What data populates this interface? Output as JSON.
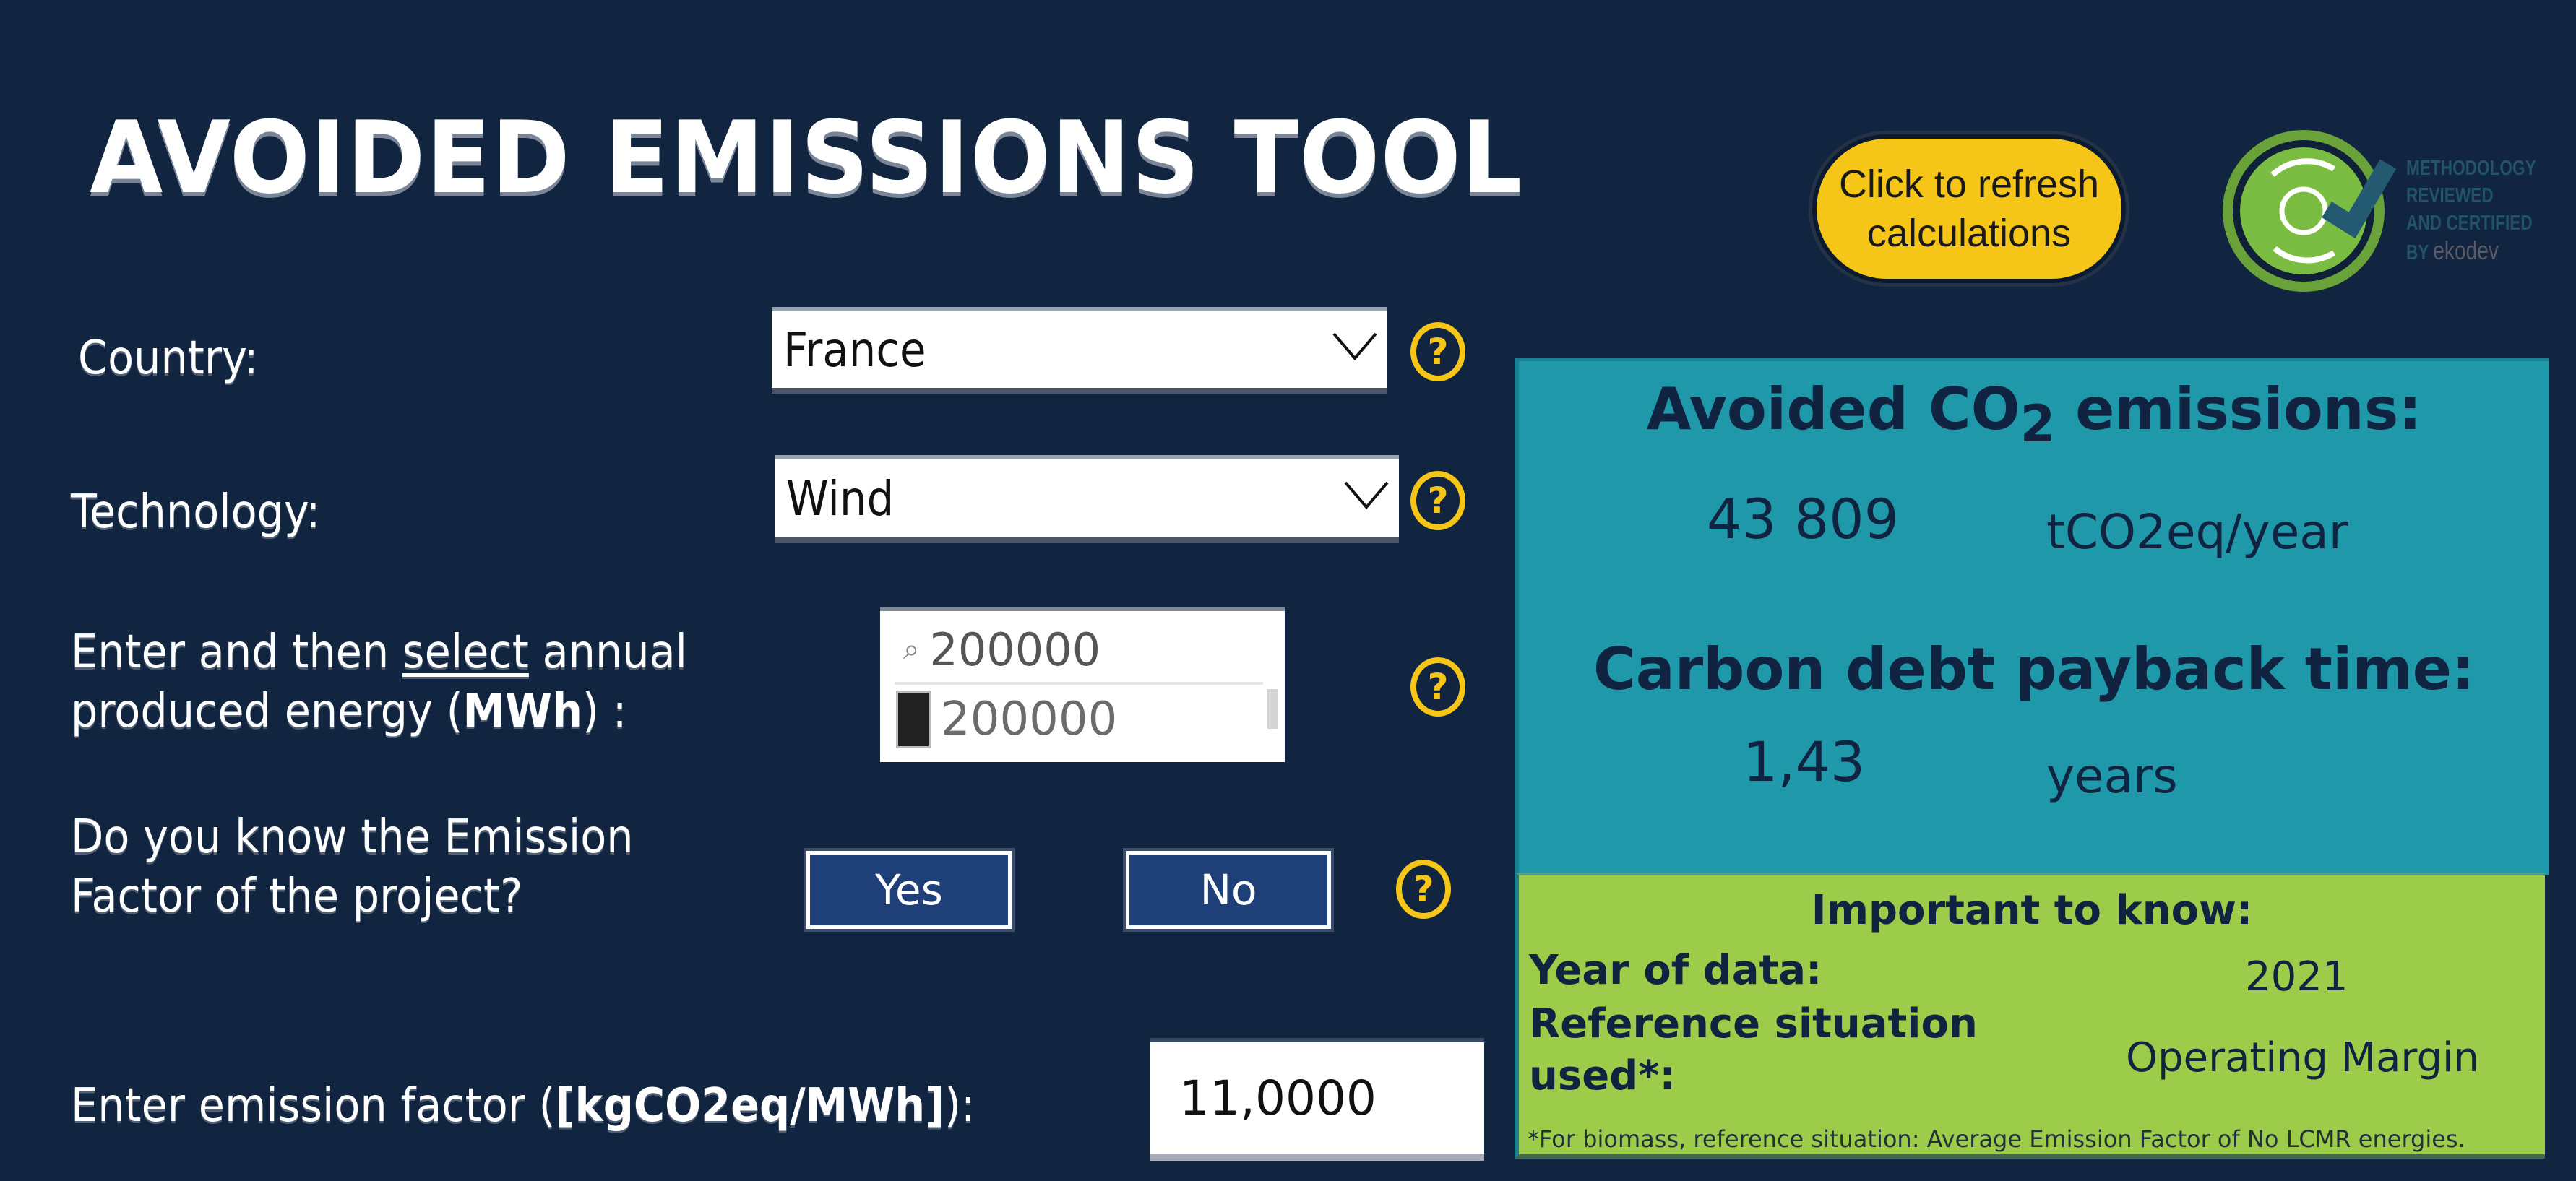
{
  "header": {
    "title": "AVOIDED EMISSIONS TOOL",
    "refresh_button": {
      "line1": "Click to refresh",
      "line2": "calculations"
    },
    "badge": {
      "line1": "METHODOLOGY",
      "line2": "REVIEWED",
      "line3": "AND CERTIFIED",
      "line4_prefix": "BY",
      "brand": "ekodev"
    }
  },
  "form": {
    "country": {
      "label": "Country:",
      "value": "France"
    },
    "technology": {
      "label": "Technology:",
      "value": "Wind"
    },
    "energy": {
      "label_part1": "Enter and then ",
      "label_underlined": "select",
      "label_part2": " annual",
      "label_line2_prefix": "produced energy (",
      "label_line2_bold": "MWh",
      "label_line2_suffix": ") :",
      "search_value": "200000",
      "option_value": "200000",
      "option_selected": true
    },
    "emission_factor_known": {
      "label_line1": "Do you know the Emission",
      "label_line2": "Factor of the project?",
      "yes_label": "Yes",
      "no_label": "No"
    },
    "emission_factor": {
      "label_prefix": "Enter emission factor (",
      "label_bold": "[kgCO2eq/MWh]",
      "label_suffix": "):",
      "value": "11,0000"
    },
    "help_icon_glyph": "?"
  },
  "results": {
    "avoided_title_prefix": "Avoided CO",
    "avoided_title_sub": "2",
    "avoided_title_suffix": " emissions:",
    "avoided_value": "43 809",
    "avoided_unit": "tCO2eq/year",
    "payback_title": "Carbon debt payback time:",
    "payback_value": "1,43",
    "payback_unit": "years"
  },
  "info": {
    "title": "Important to know:",
    "year_label": "Year of data:",
    "year_value": "2021",
    "reference_label_line1": "Reference situation",
    "reference_label_line2": "used*:",
    "reference_value": "Operating Margin",
    "footnote": "*For biomass, reference situation: Average Emission Factor of No LCMR energies."
  },
  "colors": {
    "background": "#112440",
    "accent_yellow": "#f5c518",
    "results_teal": "#1f98aa",
    "info_green": "#9dcb4a",
    "button_blue": "#1e3f78",
    "text_dark": "#102340"
  }
}
